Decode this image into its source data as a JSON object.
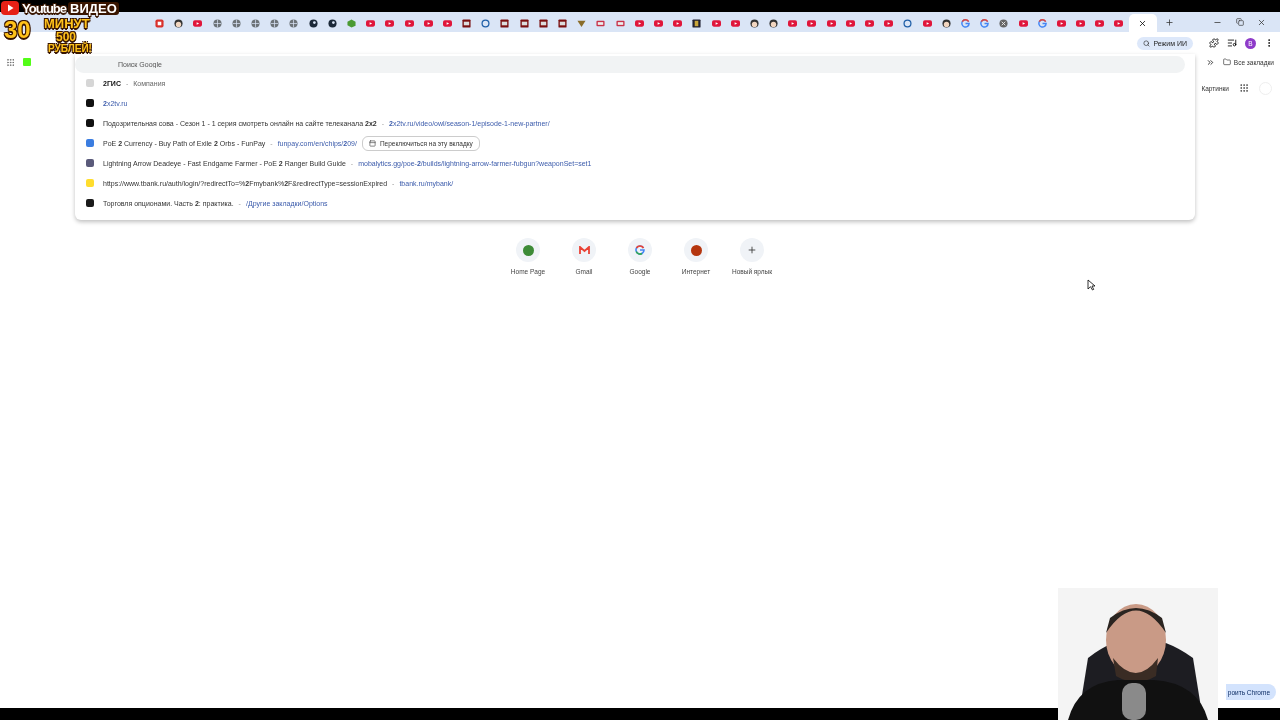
{
  "promo_overlay": {
    "brand": "Youtube",
    "video": "ВИДЕО",
    "minutes_number": "30",
    "minutes_word": "МИНУТ",
    "amount": "500",
    "currency": "РУБЛЕЙ!"
  },
  "tabs": [
    {
      "kind": "red",
      "selected": false
    },
    {
      "kind": "face",
      "selected": false
    },
    {
      "kind": "youtube",
      "selected": false
    },
    {
      "kind": "globe",
      "selected": false
    },
    {
      "kind": "globe",
      "selected": false
    },
    {
      "kind": "globe",
      "selected": false
    },
    {
      "kind": "globe",
      "selected": false
    },
    {
      "kind": "globe",
      "selected": false
    },
    {
      "kind": "disc",
      "selected": false
    },
    {
      "kind": "disc",
      "selected": false
    },
    {
      "kind": "cube",
      "selected": false
    },
    {
      "kind": "youtube",
      "selected": false
    },
    {
      "kind": "youtube",
      "selected": false
    },
    {
      "kind": "youtube",
      "selected": false
    },
    {
      "kind": "youtube",
      "selected": false
    },
    {
      "kind": "youtube",
      "selected": false
    },
    {
      "kind": "square",
      "selected": false
    },
    {
      "kind": "ring",
      "selected": false
    },
    {
      "kind": "square",
      "selected": false
    },
    {
      "kind": "square",
      "selected": false
    },
    {
      "kind": "square",
      "selected": false
    },
    {
      "kind": "square",
      "selected": false
    },
    {
      "kind": "emblem",
      "selected": false
    },
    {
      "kind": "tv",
      "selected": false
    },
    {
      "kind": "tv",
      "selected": false
    },
    {
      "kind": "youtube",
      "selected": false
    },
    {
      "kind": "youtube",
      "selected": false
    },
    {
      "kind": "youtube",
      "selected": false
    },
    {
      "kind": "dark",
      "selected": false
    },
    {
      "kind": "youtube",
      "selected": false
    },
    {
      "kind": "youtube",
      "selected": false
    },
    {
      "kind": "face",
      "selected": false
    },
    {
      "kind": "face",
      "selected": false
    },
    {
      "kind": "youtube",
      "selected": false
    },
    {
      "kind": "youtube",
      "selected": false
    },
    {
      "kind": "youtube",
      "selected": false
    },
    {
      "kind": "youtube",
      "selected": false
    },
    {
      "kind": "youtube",
      "selected": false
    },
    {
      "kind": "youtube",
      "selected": false
    },
    {
      "kind": "ring",
      "selected": false
    },
    {
      "kind": "youtube",
      "selected": false
    },
    {
      "kind": "face",
      "selected": false
    },
    {
      "kind": "google",
      "selected": false
    },
    {
      "kind": "google",
      "selected": false
    },
    {
      "kind": "blocked",
      "selected": false
    },
    {
      "kind": "youtube",
      "selected": false
    },
    {
      "kind": "google",
      "selected": false
    },
    {
      "kind": "youtube",
      "selected": false
    },
    {
      "kind": "youtube",
      "selected": false
    },
    {
      "kind": "youtube",
      "selected": false
    },
    {
      "kind": "youtube",
      "selected": false
    },
    {
      "kind": "blank",
      "selected": true
    }
  ],
  "toolbar": {
    "ai_mode_chip": "Режим ИИ",
    "profile_initial": "B"
  },
  "bookmarks_bar": {
    "all_bookmarks": "Все закладки"
  },
  "omnibox": {
    "placeholder": "Поиск Google",
    "suggestions": [
      {
        "kind": "entity",
        "color": "#d6d6d6",
        "title": "2ГИС",
        "dash": "-",
        "detail": "Компания"
      },
      {
        "kind": "url",
        "color": "#111111",
        "url": "**2**x2tv.ru"
      },
      {
        "kind": "page",
        "color": "#111111",
        "title": "Подозрительная сова - Сезон 1 - 1 серия смотреть онлайн на сайте телеканала **2x2**",
        "dash": "-",
        "url": "**2**x2tv.ru/video/owl/season-1/episode-1-new-partner/"
      },
      {
        "kind": "page",
        "color": "#3b7de0",
        "title": "PoE **2** Currency - Buy Path of Exile **2** Orbs - FunPay",
        "dash": "-",
        "url": "funpay.com/en/chips/**2**09/",
        "switch_button": "Переключиться на эту вкладку"
      },
      {
        "kind": "page",
        "color": "#5a5a7a",
        "title": "Lightning Arrow Deadeye - Fast Endgame Farmer - PoE **2** Ranger Build Guide",
        "dash": "-",
        "url": "mobalytics.gg/poe-**2**/builds/lightning-arrow-farmer-fubgun?weaponSet=set1"
      },
      {
        "kind": "page",
        "color": "#ffdd2d",
        "title": "https://www.tbank.ru/auth/login/?redirectTo=%**2**Fmybank%**2**F&redirectType=sessionExpired",
        "dash": "-",
        "url": "tbank.ru/mybank/"
      },
      {
        "kind": "page",
        "color": "#1a1a1a",
        "title": "Торговля опционами. Часть **2**: практика.",
        "dash": "-",
        "url": "/Другие закладки/Options"
      }
    ]
  },
  "page_header": {
    "images_link": "Картинки"
  },
  "shortcuts": [
    {
      "kind": "favicon",
      "color": "#3d8b37",
      "label": "Home Page"
    },
    {
      "kind": "gmail",
      "label": "Gmail"
    },
    {
      "kind": "google",
      "label": "Google"
    },
    {
      "kind": "favicon",
      "color": "#b5360f",
      "label": "Интернет"
    },
    {
      "kind": "add",
      "label": "Новый ярлык"
    }
  ],
  "customize_button": "роить Chrome"
}
